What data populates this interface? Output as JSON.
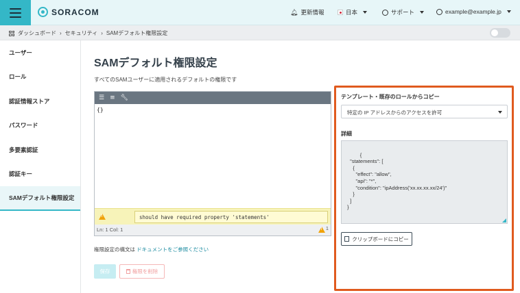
{
  "topbar": {
    "brand": "SORACOM",
    "news": "更新情報",
    "language": "日本",
    "support": "サポート",
    "account": "example@example.jp"
  },
  "breadcrumb": [
    "ダッシュボード",
    "セキュリティ",
    "SAMデフォルト権限設定"
  ],
  "sidebar": {
    "items": [
      {
        "label": "ユーザー"
      },
      {
        "label": "ロール"
      },
      {
        "label": "認証情報ストア"
      },
      {
        "label": "パスワード"
      },
      {
        "label": "多要素認証"
      },
      {
        "label": "認証キー"
      },
      {
        "label": "SAMデフォルト権限設定"
      }
    ]
  },
  "main": {
    "title": "SAMデフォルト権限設定",
    "description": "すべてのSAMユーザーに適用されるデフォルトの権限です",
    "editor": {
      "content": "{}",
      "error": "should have required property 'statements'",
      "status": "Ln: 1   Col: 1",
      "warning_count": "1"
    },
    "doc_prefix": "権限設定の構文は",
    "doc_link": "ドキュメントをご参照ください",
    "save_label": "保存",
    "delete_label": "権限を削除"
  },
  "template_panel": {
    "label": "テンプレート・既存のロールからコピー",
    "selected": "特定の IP アドレスからのアクセスを許可",
    "detail_label": "詳細",
    "json": "   {\n  \"statements\": [\n    {\n      \"effect\": \"allow\",\n      \"api\": \"*\",\n      \"condition\": \"ipAddress('xx.xx.xx.xx/24')\"\n    }\n  ]\n}",
    "copy_label": "クリップボードにコピー"
  },
  "colors": {
    "accent": "#34b7c7",
    "highlight": "#e05a1e",
    "warning": "#f0a30a"
  }
}
